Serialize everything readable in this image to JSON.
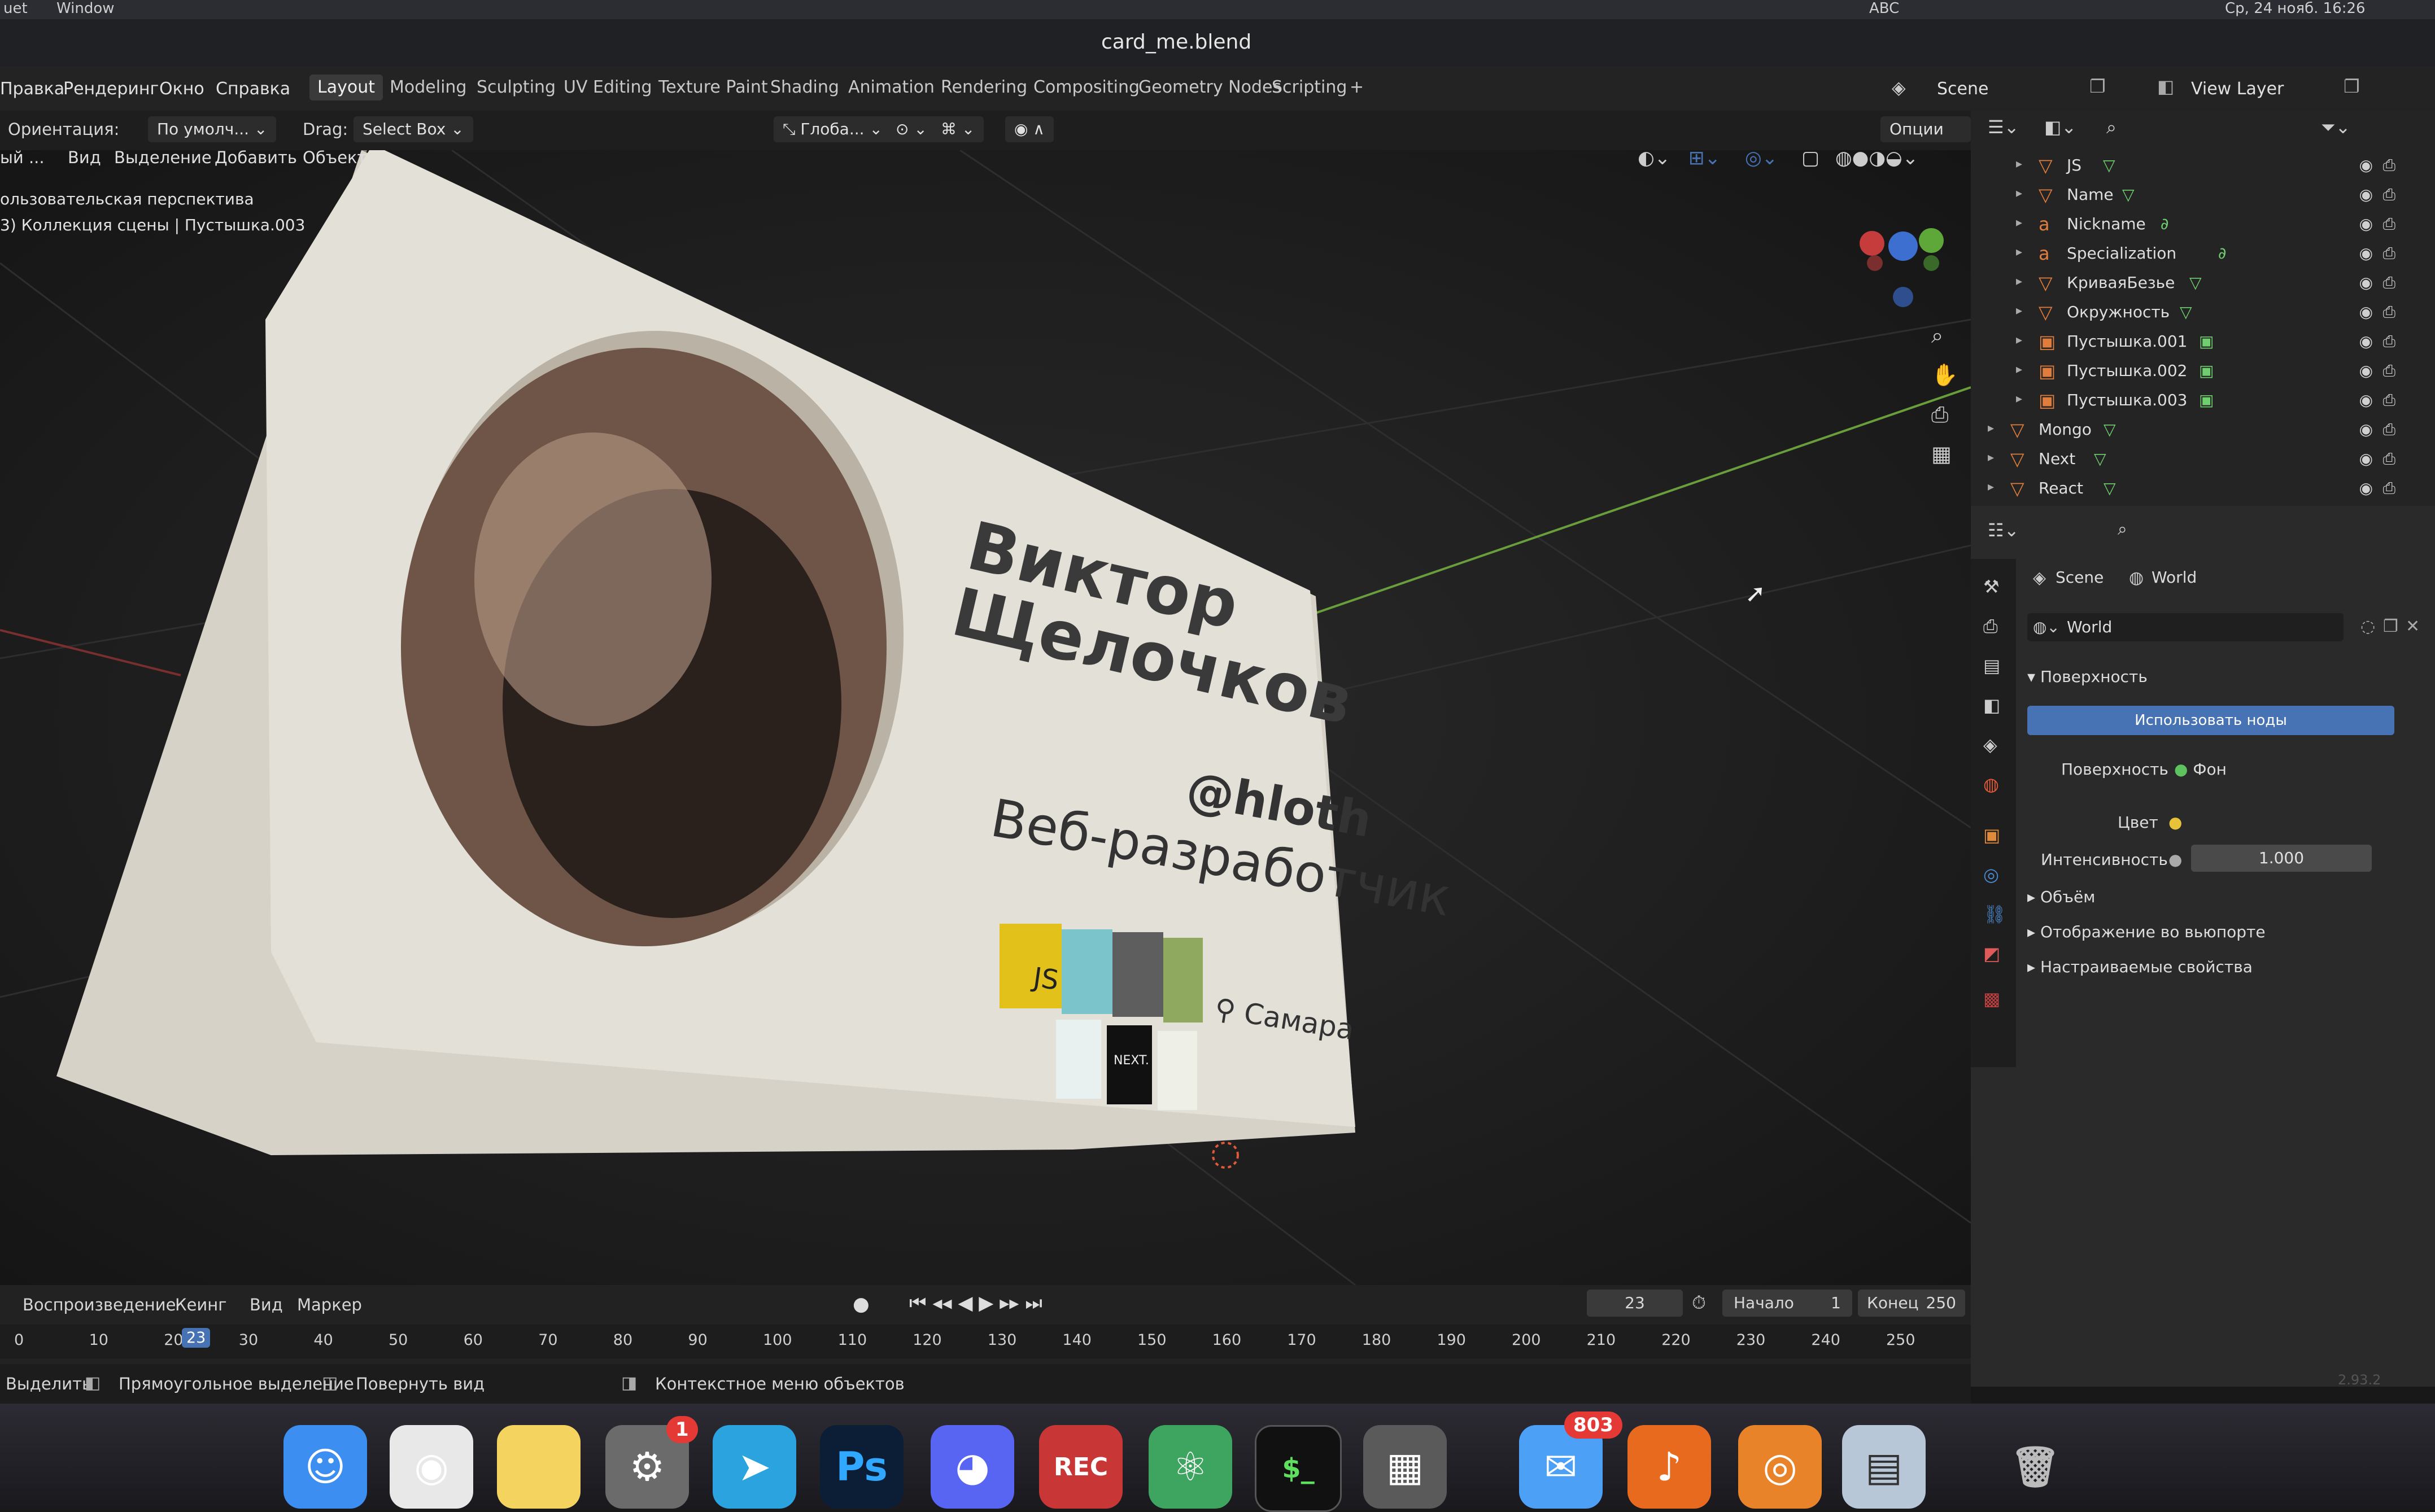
{
  "menubar": {
    "left": "uet",
    "window": "Window",
    "status_abc": "ABC",
    "clock": "Ср, 24 нояб. 16:26"
  },
  "window_title": "card_me.blend",
  "topbar": {
    "menus": [
      "Правка",
      "Рендеринг",
      "Окно",
      "Справка"
    ],
    "workspaces": [
      "Layout",
      "Modeling",
      "Sculpting",
      "UV Editing",
      "Texture Paint",
      "Shading",
      "Animation",
      "Rendering",
      "Compositing",
      "Geometry Nodes",
      "Scripting",
      "+"
    ],
    "active_workspace": "Layout",
    "scene": "Scene",
    "view_layer": "View Layer"
  },
  "header": {
    "orientation_label": "Ориентация:",
    "orientation_value": "По умолч...",
    "drag_label": "Drag:",
    "drag_value": "Select Box",
    "transform": "Глоба...",
    "options": "Опции"
  },
  "viewport": {
    "menu": [
      "ый ...",
      "Вид",
      "Выделение",
      "Добавить",
      "Объект"
    ],
    "info_line1": "ользовательская перспектива",
    "info_line2": "3) Коллекция сцены | Пустышка.003",
    "card": {
      "name_line1": "Виктор",
      "name_line2": "Щелочков",
      "nickname": "@hloth",
      "role": "Веб-разработчик",
      "city": "Самара",
      "js_label": "JS",
      "next_label": "NEXT."
    }
  },
  "outliner": {
    "rows": [
      {
        "name": "JS",
        "indent": 1,
        "obj_icon": "▽",
        "data_icon": "▽"
      },
      {
        "name": "Name",
        "indent": 1,
        "obj_icon": "▽",
        "data_icon": "▽"
      },
      {
        "name": "Nickname",
        "indent": 1,
        "obj_icon": "a",
        "data_icon": "∂"
      },
      {
        "name": "Specialization",
        "indent": 1,
        "obj_icon": "a",
        "data_icon": "∂"
      },
      {
        "name": "КриваяБезье",
        "indent": 1,
        "obj_icon": "▽",
        "data_icon": "▽"
      },
      {
        "name": "Окружность",
        "indent": 1,
        "obj_icon": "▽",
        "data_icon": "▽"
      },
      {
        "name": "Пустышка.001",
        "indent": 1,
        "obj_icon": "▣",
        "data_icon": "▣"
      },
      {
        "name": "Пустышка.002",
        "indent": 1,
        "obj_icon": "▣",
        "data_icon": "▣"
      },
      {
        "name": "Пустышка.003",
        "indent": 1,
        "obj_icon": "▣",
        "data_icon": "▣"
      },
      {
        "name": "Mongo",
        "indent": 0,
        "obj_icon": "▽",
        "data_icon": "▽"
      },
      {
        "name": "Next",
        "indent": 0,
        "obj_icon": "▽",
        "data_icon": "▽"
      },
      {
        "name": "React",
        "indent": 0,
        "obj_icon": "▽",
        "data_icon": "▽"
      }
    ]
  },
  "properties": {
    "breadcrumb_scene": "Scene",
    "breadcrumb_world": "World",
    "world_name": "World",
    "surface_section": "Поверхность",
    "use_nodes_button": "Использовать ноды",
    "surface_label": "Поверхность",
    "surface_value": "Фон",
    "color_label": "Цвет",
    "strength_label": "Интенсивность",
    "strength_value": "1.000",
    "volume_section": "Объём",
    "viewport_display_section": "Отображение во вьюпорте",
    "custom_props_section": "Настраиваемые свойства"
  },
  "timeline": {
    "menu": [
      "Воспроизведение",
      "Кеинг",
      "Вид",
      "Маркер"
    ],
    "current_frame": "23",
    "start_label": "Начало",
    "start_value": "1",
    "end_label": "Конец",
    "end_value": "250",
    "ticks": [
      "0",
      "10",
      "20",
      "30",
      "40",
      "50",
      "60",
      "70",
      "80",
      "90",
      "100",
      "110",
      "120",
      "130",
      "140",
      "150",
      "160",
      "170",
      "180",
      "190",
      "200",
      "210",
      "220",
      "230",
      "240",
      "250"
    ]
  },
  "statusbar": {
    "select": "Выделить",
    "box_select": "Прямоугольное выделение",
    "rotate_view": "Повернуть вид",
    "context_menu": "Контекстное меню объектов",
    "version": "2.93.2"
  },
  "dock": {
    "items": [
      {
        "name": "finder",
        "label": "☺",
        "color": "#3c8ef0"
      },
      {
        "name": "chrome",
        "label": "◉",
        "color": "#e8e8e8"
      },
      {
        "name": "notes",
        "label": "",
        "color": "#f4d35e"
      },
      {
        "name": "system-preferences",
        "label": "⚙",
        "color": "#6b6b6b"
      },
      {
        "name": "telegram",
        "label": "➤",
        "color": "#2aa3df"
      },
      {
        "name": "photoshop",
        "label": "Ps",
        "color": "#0b1e35"
      },
      {
        "name": "discord",
        "label": "◕",
        "color": "#5865f2"
      },
      {
        "name": "photo-booth",
        "label": "REC",
        "color": "#c93636"
      },
      {
        "name": "atom",
        "label": "⚛",
        "color": "#3da55f"
      },
      {
        "name": "terminal",
        "label": "$_",
        "color": "#111111"
      },
      {
        "name": "calculator",
        "label": "▦",
        "color": "#5a5a5a"
      },
      {
        "name": "mail",
        "label": "✉",
        "color": "#4ca0f5"
      },
      {
        "name": "garageband",
        "label": "♪",
        "color": "#e86a1f"
      },
      {
        "name": "blender",
        "label": "◎",
        "color": "#e8832a"
      },
      {
        "name": "preview",
        "label": "▤",
        "color": "#b7c7d8"
      },
      {
        "name": "trash",
        "label": "🗑",
        "color": "#8a8a8a"
      }
    ],
    "sys_prefs_badge": "1",
    "mail_badge": "803"
  },
  "colors": {
    "blender_accent": "#4772b3",
    "object_orange": "#e07d3c",
    "axis_green": "#6a9e3c",
    "axis_red": "#c0392b"
  }
}
